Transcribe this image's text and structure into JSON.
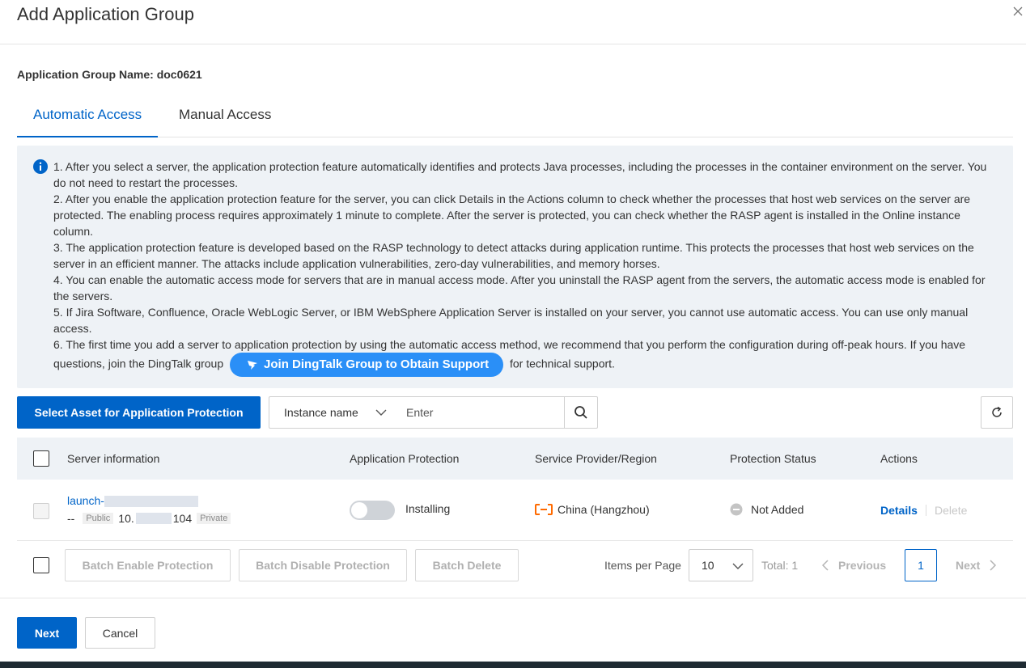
{
  "dialog": {
    "title": "Add Application Group"
  },
  "group": {
    "label": "Application Group Name:",
    "value": "doc0621"
  },
  "tabs": [
    {
      "label": "Automatic Access",
      "active": true
    },
    {
      "label": "Manual Access",
      "active": false
    }
  ],
  "info": {
    "lines": [
      "1. After you select a server, the application protection feature automatically identifies and protects Java processes, including the processes in the container environment on the server. You do not need to restart the processes.",
      "2. After you enable the application protection feature for the server, you can click Details in the Actions column to check whether the processes that host web services on the server are protected. The enabling process requires approximately 1 minute to complete. After the server is protected, you can check whether the RASP agent is installed in the Online instance column.",
      "3. The application protection feature is developed based on the RASP technology to detect attacks during application runtime. This protects the processes that host web services on the server in an efficient manner. The attacks include application vulnerabilities, zero-day vulnerabilities, and memory horses.",
      "4. You can enable the automatic access mode for servers that are in manual access mode. After you uninstall the RASP agent from the servers, the automatic access mode is enabled for the servers.",
      "5. If Jira Software, Confluence, Oracle WebLogic Server, or IBM WebSphere Application Server is installed on your server, you cannot use automatic access. You can use only manual access."
    ],
    "line6_before": "6. The first time you add a server to application protection by using the automatic access method, we recommend that you perform the configuration during off-peak hours. If you have questions, join the DingTalk group",
    "dingtalk_button": "Join DingTalk Group to Obtain Support",
    "line6_after": "for technical support."
  },
  "toolbar": {
    "select_asset_button": "Select Asset for Application Protection",
    "search_type": "Instance name",
    "search_placeholder": "Enter"
  },
  "table": {
    "headers": {
      "server": "Server information",
      "protection": "Application Protection",
      "region": "Service Provider/Region",
      "status": "Protection Status",
      "actions": "Actions"
    },
    "rows": [
      {
        "name_prefix": "launch-",
        "ip_dash": "--",
        "public_tag": "Public",
        "ip_prefix": "10.",
        "ip_suffix": "104",
        "private_tag": "Private",
        "protection_text": "Installing",
        "protection_enabled": false,
        "region": "China (Hangzhou)",
        "status": "Not Added",
        "details": "Details",
        "delete": "Delete"
      }
    ]
  },
  "batch": {
    "enable": "Batch Enable Protection",
    "disable": "Batch Disable Protection",
    "delete": "Batch Delete"
  },
  "pager": {
    "items_per_page_label": "Items per Page",
    "page_size": "10",
    "total": "Total: 1",
    "previous": "Previous",
    "next": "Next",
    "current_page": "1"
  },
  "footer": {
    "next_button": "Next",
    "cancel_button": "Cancel"
  },
  "colors": {
    "primary": "#0064c8",
    "info_bg": "#eef2f6",
    "dingtalk": "#2a8ff7",
    "aliyun_orange": "#ff6a00"
  }
}
